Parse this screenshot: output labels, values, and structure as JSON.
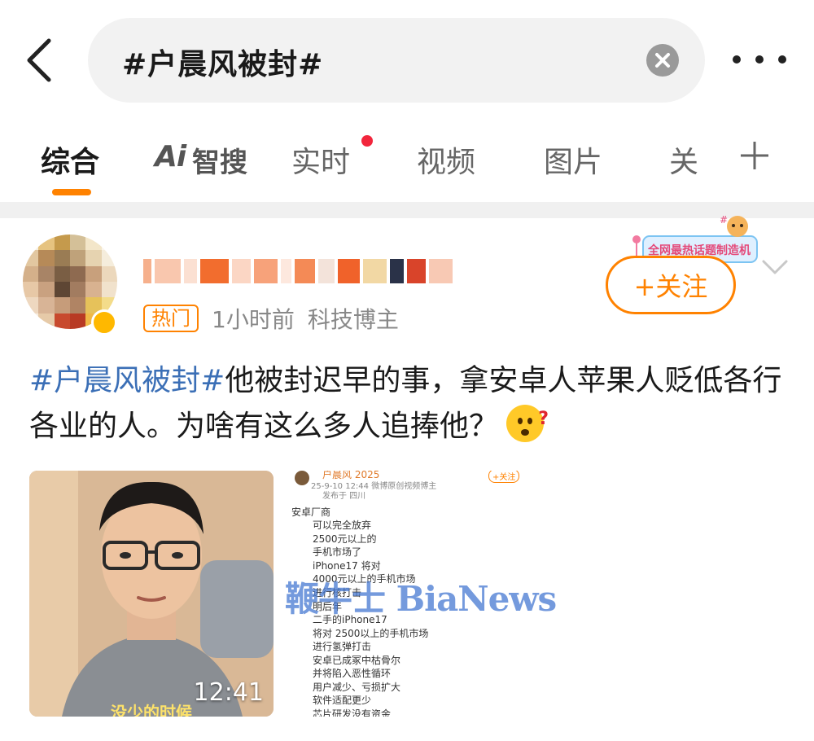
{
  "header": {
    "search_query": "#户晨风被封#"
  },
  "tabs": [
    {
      "label": "综合"
    },
    {
      "label": "Ai"
    },
    {
      "label": "智搜"
    },
    {
      "label": "实时"
    },
    {
      "label": "视频"
    },
    {
      "label": "图片"
    },
    {
      "label": "关"
    }
  ],
  "post": {
    "username": "",
    "hot_badge": "热门",
    "time": "1小时前",
    "role": "科技博主",
    "follow_label": "+关注",
    "fan_banner_text": "全网最热话题制造机",
    "text_tag": "#户晨风被封#",
    "text_body": "他被封迟早的事，拿安卓人苹果人贬低各行各业的人。为啥有这么多人追捧他？",
    "emoji_name": "thinking-emoji",
    "video_duration": "12:41",
    "video_caption": "没少的时候",
    "watermark": "鞭牛士 BiaNews",
    "screenshot": {
      "name": "户晨风 2025",
      "follow": "+关注",
      "meta_line": "25-9-10 12:44  微博原创视频博主",
      "location": "发布于 四川",
      "lines": [
        "安卓厂商",
        "可以完全放弃",
        "2500元以上的",
        "手机市场了",
        "iPhone17 将对",
        "4000元以上的手机市场",
        "进行核打击",
        "明后年",
        "二手的iPhone17",
        "将对 2500以上的手机市场",
        "进行氢弹打击",
        "安卓已成冢中枯骨尔",
        "并将陷入恶性循环",
        "用户减少、亏损扩大",
        "软件适配更少",
        "芯片研发没有资金"
      ]
    }
  },
  "colors": {
    "accent": "#ff8200",
    "tag_blue": "#3b6fb6",
    "live_dot": "#f2263c"
  }
}
